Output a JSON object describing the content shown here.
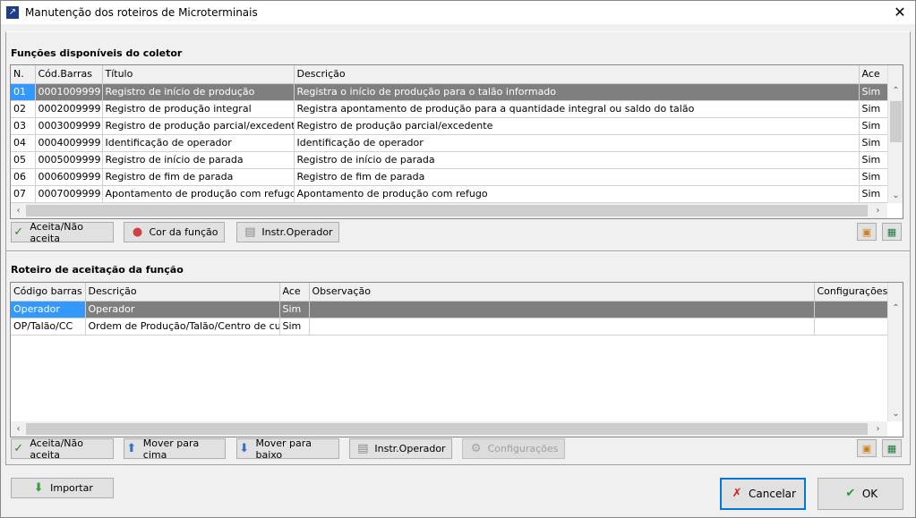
{
  "window": {
    "title": "Manutenção dos roteiros de Microterminais",
    "close": "✕"
  },
  "functions": {
    "section_title": "Funções disponíveis do coletor",
    "columns": [
      "N.",
      "Cód.Barras",
      "Título",
      "Descrição",
      "Ace"
    ],
    "rows": [
      [
        "01",
        "0001009999",
        "Registro de início de produção",
        "Registra o início de produção para o talão informado",
        "Sim"
      ],
      [
        "02",
        "0002009999",
        "Registro de produção integral",
        "Registra apontamento de produção para a quantidade integral ou saldo do talão",
        "Sim"
      ],
      [
        "03",
        "0003009999",
        "Registro de produção parcial/excedente",
        "Registro de produção parcial/excedente",
        "Sim"
      ],
      [
        "04",
        "0004009999",
        "Identificação de operador",
        "Identificação de operador",
        "Sim"
      ],
      [
        "05",
        "0005009999",
        "Registro de início de parada",
        "Registro de início de parada",
        "Sim"
      ],
      [
        "06",
        "0006009999",
        "Registro de fim de parada",
        "Registro de fim de parada",
        "Sim"
      ],
      [
        "07",
        "0007009999",
        "Apontamento de produção com refugo",
        "Apontamento de produção com refugo",
        "Sim"
      ]
    ],
    "buttons": {
      "accept": "Aceita/Não aceita",
      "color": "Cor da função",
      "instr": "Instr.Operador"
    }
  },
  "route": {
    "section_title": "Roteiro de aceitação da função",
    "columns": [
      "Código barras",
      "Descrição",
      "Ace",
      "Observação",
      "Configurações"
    ],
    "rows": [
      [
        "Operador",
        "Operador",
        "Sim",
        "",
        ""
      ],
      [
        "OP/Talão/CC",
        "Ordem de Produção/Talão/Centro de custo",
        "Sim",
        "",
        ""
      ]
    ],
    "buttons": {
      "accept": "Aceita/Não aceita",
      "up": "Mover para cima",
      "down": "Mover para baixo",
      "instr": "Instr.Operador",
      "config": "Configurações"
    }
  },
  "footer": {
    "import": "Importar",
    "cancel": "Cancelar",
    "ok": "OK"
  }
}
